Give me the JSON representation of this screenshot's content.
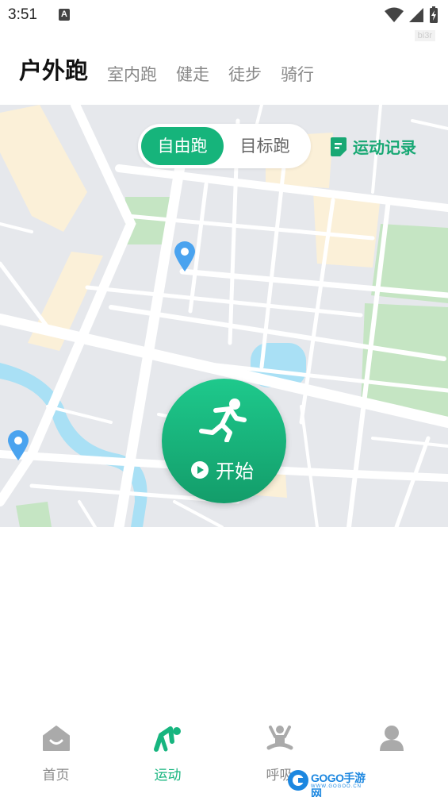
{
  "status_bar": {
    "time": "3:51",
    "notification_icon": "a-icon",
    "tag": "bi3r"
  },
  "top_tabs": [
    {
      "label": "户外跑",
      "active": true
    },
    {
      "label": "室内跑",
      "active": false
    },
    {
      "label": "健走",
      "active": false
    },
    {
      "label": "徒步",
      "active": false
    },
    {
      "label": "骑行",
      "active": false
    }
  ],
  "mode_toggle": {
    "options": [
      "自由跑",
      "目标跑"
    ],
    "selected": "自由跑"
  },
  "record_link": {
    "label": "运动记录",
    "icon": "record-icon"
  },
  "start_button": {
    "label": "开始",
    "icon": "running-person-icon"
  },
  "bottom_nav": [
    {
      "label": "首页",
      "icon": "home-icon",
      "active": false
    },
    {
      "label": "运动",
      "icon": "exercise-icon",
      "active": true
    },
    {
      "label": "呼吸",
      "icon": "meditation-icon",
      "active": false
    },
    {
      "label": "",
      "icon": "profile-icon",
      "active": false
    }
  ],
  "watermark": {
    "title": "GOGO手游网",
    "sub": "WWW.GOGOO.CN"
  },
  "colors": {
    "accent": "#17b57f",
    "map_bg": "#e6e8ec",
    "pin": "#4aa3ef"
  }
}
